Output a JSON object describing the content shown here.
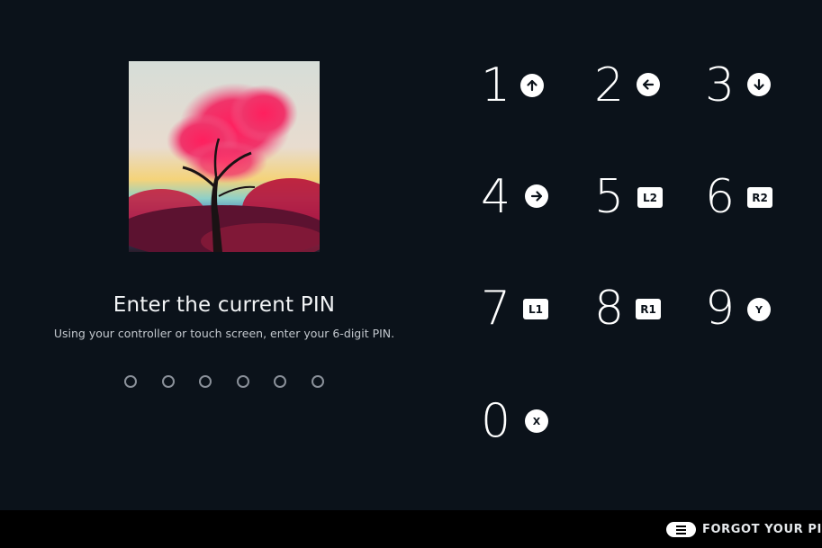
{
  "pin_entry": {
    "title": "Enter the current PIN",
    "subtitle": "Using your controller or touch screen, enter your 6-digit PIN.",
    "pin_length": 6,
    "digits_entered": 0
  },
  "keypad": {
    "keys": [
      {
        "digit": "1",
        "button_glyph": "arrow-up-icon",
        "glyph_label": ""
      },
      {
        "digit": "2",
        "button_glyph": "arrow-left-icon",
        "glyph_label": ""
      },
      {
        "digit": "3",
        "button_glyph": "arrow-down-icon",
        "glyph_label": ""
      },
      {
        "digit": "4",
        "button_glyph": "arrow-right-icon",
        "glyph_label": ""
      },
      {
        "digit": "5",
        "button_glyph": "l2-trigger-icon",
        "glyph_label": "L2"
      },
      {
        "digit": "6",
        "button_glyph": "r2-trigger-icon",
        "glyph_label": "R2"
      },
      {
        "digit": "7",
        "button_glyph": "l1-bumper-icon",
        "glyph_label": "L1"
      },
      {
        "digit": "8",
        "button_glyph": "r1-bumper-icon",
        "glyph_label": "R1"
      },
      {
        "digit": "9",
        "button_glyph": "y-button-icon",
        "glyph_label": "Y"
      },
      {
        "digit": "0",
        "button_glyph": "x-button-icon",
        "glyph_label": "X"
      }
    ]
  },
  "footer": {
    "forgot_label": "FORGOT YOUR PIN",
    "forgot_glyph": "menu-button-icon"
  },
  "colors": {
    "background": "#0b121a",
    "footer_background": "#000000",
    "text": "#ffffff",
    "pin_dot_outline": "#8a9099"
  }
}
